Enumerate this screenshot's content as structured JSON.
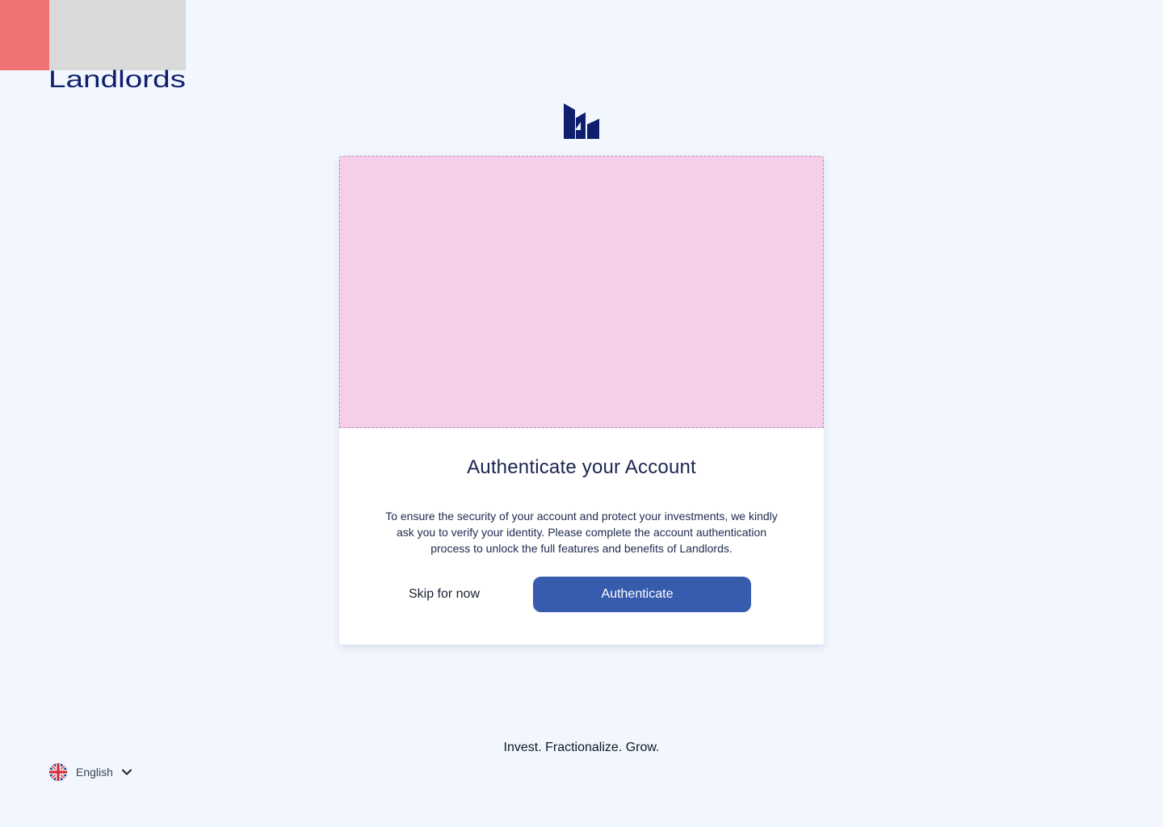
{
  "brand": {
    "wordmark": "Landlords",
    "logo_icon": "landlords-emblem-icon",
    "colors": {
      "navy": "#0f1f6e",
      "accent_red": "#f07373",
      "placeholder_gray": "#d9d9d9"
    }
  },
  "card": {
    "media_color": "#f5cfe9",
    "title": "Authenticate your Account",
    "body": "To ensure the security of your account and protect your investments, we kindly ask you to verify your identity. Please complete the account authentication process to unlock the full features and benefits of Landlords.",
    "skip_label": "Skip for now",
    "authenticate_label": "Authenticate",
    "primary_color": "#375bad"
  },
  "footer": {
    "tagline": "Invest. Fractionalize. Grow.",
    "language": {
      "label": "English",
      "icon": "uk-flag-icon",
      "dropdown_icon": "chevron-down-icon"
    }
  }
}
